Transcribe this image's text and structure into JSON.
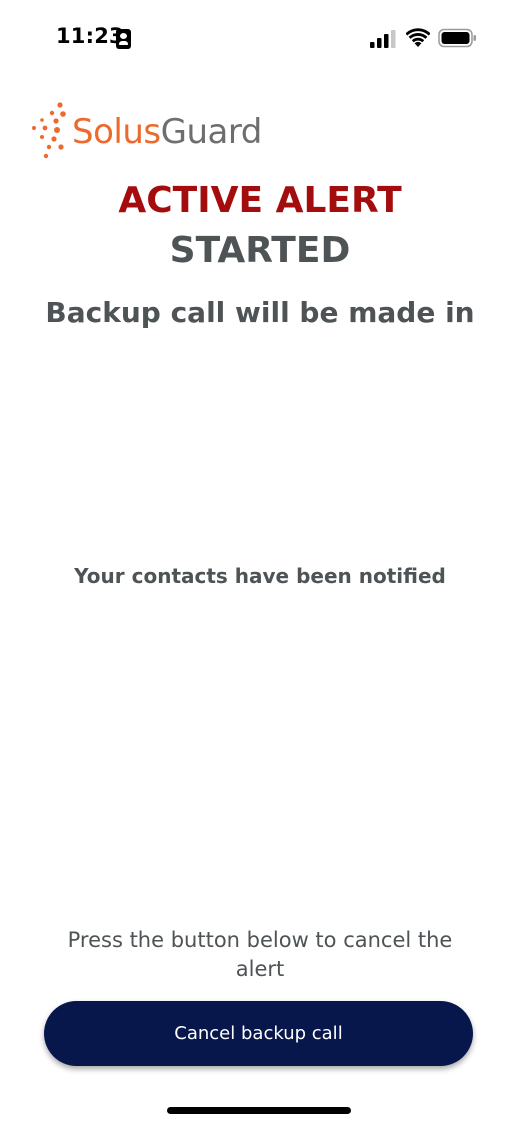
{
  "status_bar": {
    "time": "11:23",
    "icons": [
      "contact-badge-icon",
      "cellular-signal-icon",
      "wifi-icon",
      "battery-icon"
    ]
  },
  "logo": {
    "brand_part_1": "Solus",
    "brand_part_2": "Guard",
    "colors": {
      "solus": "#ec6a2c",
      "guard": "#6e6e6e"
    }
  },
  "alert": {
    "title_line_1": "ACTIVE ALERT",
    "title_line_2": "STARTED",
    "subtitle": "Backup call will be made in",
    "contacts_note": "Your contacts have been notified",
    "colors": {
      "alert_red": "#a40d0d",
      "text_gray": "#4e5356"
    }
  },
  "footer": {
    "instructions": "Press the button below to cancel the alert",
    "cancel_button_label": "Cancel backup call",
    "button_color": "#07174b"
  }
}
